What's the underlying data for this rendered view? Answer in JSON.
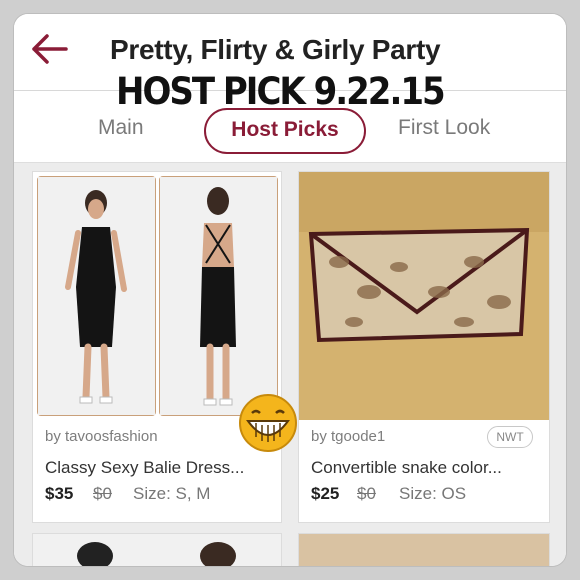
{
  "header": {
    "title": "Pretty, Flirty & Girly Party",
    "overlay_text": "HOST PICK 9.22.15"
  },
  "tabs": [
    {
      "label": "Main"
    },
    {
      "label": "Host Picks"
    },
    {
      "label": "First Look"
    }
  ],
  "listings": [
    {
      "seller": "by tavoosfashion",
      "name": "Classy Sexy Balie Dress...",
      "price": "$35",
      "original_price": "$0",
      "size": "Size: S, M"
    },
    {
      "seller": "by tgoode1",
      "name": "Convertible snake color...",
      "price": "$25",
      "original_price": "$0",
      "size": "Size: OS",
      "badge": "NWT"
    }
  ],
  "colors": {
    "accent": "#8a1c37",
    "background": "#ececec"
  }
}
